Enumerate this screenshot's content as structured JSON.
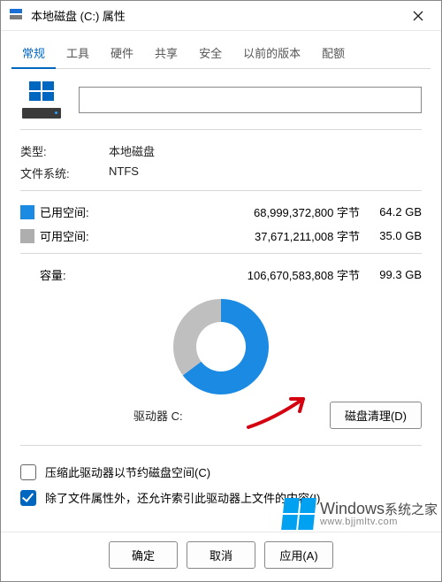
{
  "window": {
    "title": "本地磁盘 (C:) 属性"
  },
  "tabs": [
    {
      "label": "常规",
      "active": true
    },
    {
      "label": "工具",
      "active": false
    },
    {
      "label": "硬件",
      "active": false
    },
    {
      "label": "共享",
      "active": false
    },
    {
      "label": "安全",
      "active": false
    },
    {
      "label": "以前的版本",
      "active": false
    },
    {
      "label": "配额",
      "active": false
    }
  ],
  "general": {
    "name_value": "",
    "type_label": "类型:",
    "type_value": "本地磁盘",
    "fs_label": "文件系统:",
    "fs_value": "NTFS",
    "used_label": "已用空间:",
    "used_bytes": "68,999,372,800 字节",
    "used_human": "64.2 GB",
    "free_label": "可用空间:",
    "free_bytes": "37,671,211,008 字节",
    "free_human": "35.0 GB",
    "capacity_label": "容量:",
    "capacity_bytes": "106,670,583,808 字节",
    "capacity_human": "99.3 GB",
    "drive_label": "驱动器 C:",
    "cleanup_button": "磁盘清理(D)",
    "compress_label": "压缩此驱动器以节约磁盘空间(C)",
    "index_label": "除了文件属性外，还允许索引此驱动器上文件的内容(I)",
    "compress_checked": false,
    "index_checked": true
  },
  "footer": {
    "ok": "确定",
    "cancel": "取消",
    "apply": "应用(A)"
  },
  "watermark": {
    "brand": "Windows",
    "sub": "系统之家",
    "url": "www.bjjmltv.com"
  },
  "chart_data": {
    "type": "pie",
    "title": "",
    "series": [
      {
        "name": "已用空间",
        "value": 68999372800,
        "human": "64.2 GB",
        "color": "#1a8ae2"
      },
      {
        "name": "可用空间",
        "value": 37671211008,
        "human": "35.0 GB",
        "color": "#bfbfbf"
      }
    ],
    "total": {
      "value": 106670583808,
      "human": "99.3 GB"
    }
  }
}
